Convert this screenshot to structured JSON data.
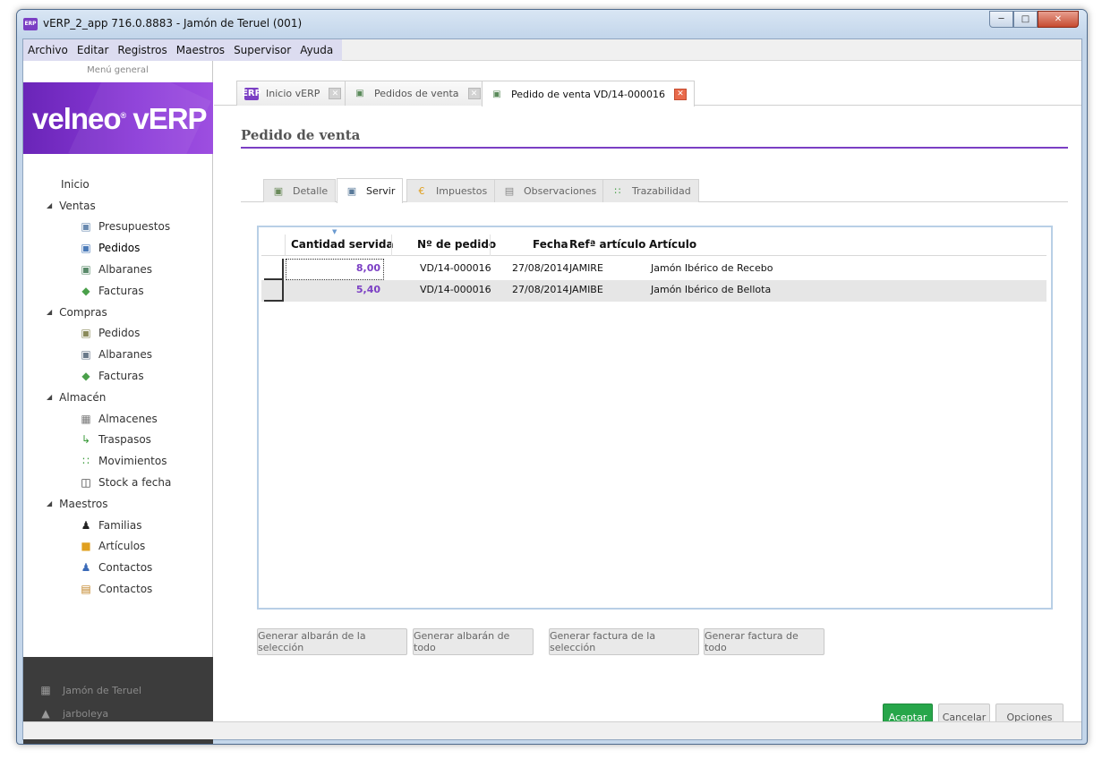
{
  "window": {
    "title": "vERP_2_app 716.0.8883 - Jamón de Teruel (001)",
    "app_icon": "ERP"
  },
  "menubar": [
    "Archivo",
    "Editar",
    "Registros",
    "Maestros",
    "Supervisor",
    "Ayuda"
  ],
  "sidebar": {
    "title": "Menú general",
    "logo": "velneo",
    "logo_suffix": "vERP",
    "inicio": "Inicio",
    "groups": [
      {
        "label": "Ventas",
        "items": [
          {
            "label": "Presupuestos",
            "icon": "quote-icon"
          },
          {
            "label": "Pedidos",
            "icon": "order-icon"
          },
          {
            "label": "Albaranes",
            "icon": "delivery-note-icon"
          },
          {
            "label": "Facturas",
            "icon": "invoice-icon"
          }
        ]
      },
      {
        "label": "Compras",
        "items": [
          {
            "label": "Pedidos",
            "icon": "purchase-order-icon"
          },
          {
            "label": "Albaranes",
            "icon": "purchase-delivery-icon"
          },
          {
            "label": "Facturas",
            "icon": "purchase-invoice-icon"
          }
        ]
      },
      {
        "label": "Almacén",
        "items": [
          {
            "label": "Almacenes",
            "icon": "warehouse-icon"
          },
          {
            "label": "Traspasos",
            "icon": "transfer-icon"
          },
          {
            "label": "Movimientos",
            "icon": "movements-icon"
          },
          {
            "label": "Stock a fecha",
            "icon": "stock-date-icon"
          }
        ]
      },
      {
        "label": "Maestros",
        "items": [
          {
            "label": "Familias",
            "icon": "families-icon"
          },
          {
            "label": "Artículos",
            "icon": "articles-icon"
          },
          {
            "label": "Contactos",
            "icon": "contacts-icon"
          },
          {
            "label": "Contactos",
            "icon": "contacts-card-icon"
          }
        ]
      }
    ],
    "footer": {
      "company": "Jamón de Teruel",
      "user": "jarboleya"
    }
  },
  "doc_tabs": [
    {
      "label": "Inicio vERP",
      "icon": "erp-icon"
    },
    {
      "label": "Pedidos de venta",
      "icon": "order-icon"
    },
    {
      "label": "Pedido de venta VD/14-000016",
      "icon": "order-icon"
    }
  ],
  "page": {
    "title": "Pedido de venta"
  },
  "sub_tabs": [
    {
      "label": "Detalle",
      "icon": "detail-icon"
    },
    {
      "label": "Servir",
      "icon": "serve-icon"
    },
    {
      "label": "Impuestos",
      "icon": "euro-icon"
    },
    {
      "label": "Observaciones",
      "icon": "notes-icon"
    },
    {
      "label": "Trazabilidad",
      "icon": "traceability-icon"
    }
  ],
  "grid": {
    "columns": [
      "Cantidad servida",
      "Nº de pedido",
      "Fecha",
      "Refª artículo",
      "Artículo"
    ],
    "rows": [
      [
        "8,00",
        "VD/14-000016",
        "27/08/2014",
        "JAMIRE",
        "Jamón Ibérico de Recebo"
      ],
      [
        "5,40",
        "VD/14-000016",
        "27/08/2014",
        "JAMIBE",
        "Jamón Ibérico de Bellota"
      ]
    ]
  },
  "actions": [
    "Generar albarán de la selección",
    "Generar albarán de todo",
    "Generar factura de la selección",
    "Generar factura de todo"
  ],
  "dialog_buttons": {
    "accept": "Aceptar",
    "cancel": "Cancelar",
    "options": "Opciones"
  },
  "colors": {
    "accent": "#7b3fc4",
    "accept": "#27a64a",
    "banner": "#7b33c8"
  }
}
